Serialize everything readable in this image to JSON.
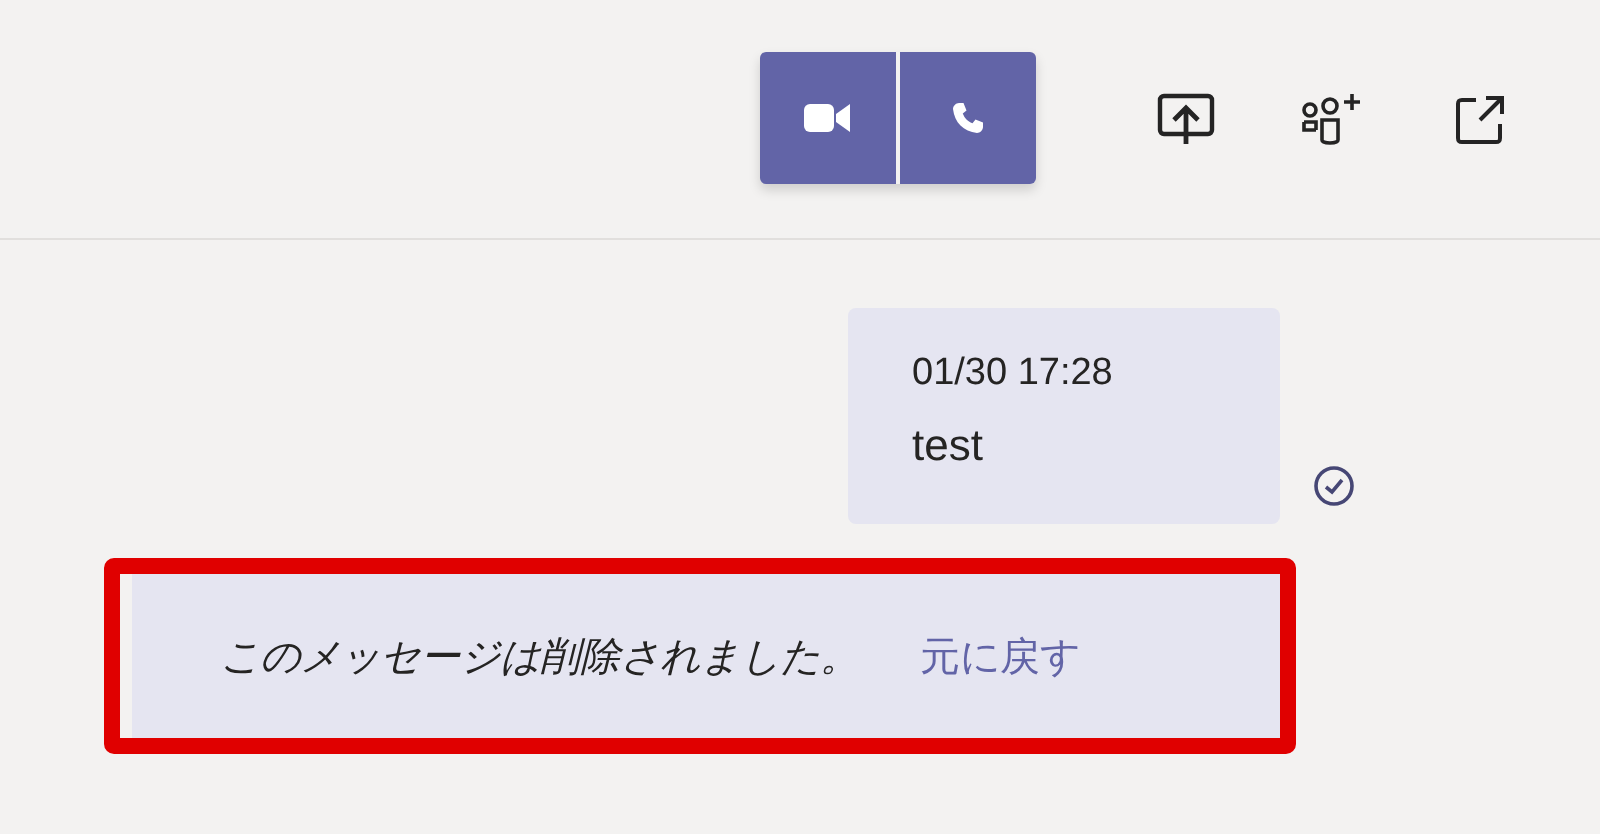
{
  "message": {
    "time": "01/30 17:28",
    "text": "test",
    "sent": true
  },
  "deleted_notice": {
    "text": "このメッセージは削除されました。",
    "undo_link": "元に戻す",
    "highlighted": true
  }
}
